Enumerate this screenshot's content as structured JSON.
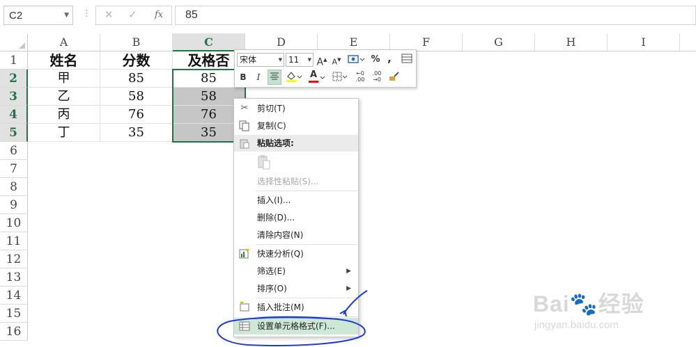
{
  "formula_bar": {
    "name_box": "C2",
    "cancel_icon": "✕",
    "enter_icon": "✓",
    "fx_label": "fx",
    "formula": "85"
  },
  "columns": [
    "A",
    "B",
    "C",
    "D",
    "E",
    "F",
    "G",
    "H",
    "I"
  ],
  "rows": [
    "1",
    "2",
    "3",
    "4",
    "5",
    "6",
    "7",
    "8",
    "9",
    "10",
    "11",
    "12",
    "13",
    "14",
    "15",
    "16"
  ],
  "selected_column": "C",
  "selected_rows": [
    "2",
    "3",
    "4",
    "5"
  ],
  "cells": {
    "A1": "姓名",
    "B1": "分数",
    "C1": "及格否",
    "A2": "甲",
    "B2": "85",
    "C2": "85",
    "A3": "乙",
    "B3": "58",
    "C3": "58",
    "A4": "丙",
    "B4": "76",
    "C4": "76",
    "A5": "丁",
    "B5": "35",
    "C5": "35"
  },
  "mini_toolbar": {
    "font_name": "宋体",
    "font_size": "11",
    "bold": "B",
    "italic": "I",
    "percent": "%",
    "comma": ",",
    "increase_font": "A",
    "decrease_font": "A",
    "font_color": "A",
    "fill_color_value": "#ffff00",
    "font_color_value": "#ff0000"
  },
  "context_menu": {
    "items": [
      {
        "label": "剪切(T)",
        "icon": "scissors-icon"
      },
      {
        "label": "复制(C)",
        "icon": "copy-icon"
      },
      {
        "label": "粘贴选项:",
        "icon": "paste-icon"
      },
      {
        "label": "选择性粘贴(S)...",
        "icon": ""
      },
      {
        "label": "插入(I)...",
        "icon": ""
      },
      {
        "label": "删除(D)...",
        "icon": ""
      },
      {
        "label": "清除内容(N)",
        "icon": ""
      },
      {
        "label": "快速分析(Q)",
        "icon": "quick-analysis-icon"
      },
      {
        "label": "筛选(E)",
        "icon": ""
      },
      {
        "label": "排序(O)",
        "icon": ""
      },
      {
        "label": "插入批注(M)",
        "icon": "comment-icon"
      },
      {
        "label": "设置单元格格式(F)...",
        "icon": "format-cells-icon"
      }
    ]
  },
  "watermark": {
    "brand": "Bai",
    "cn": "经验",
    "url": "jingyan.baidu.com"
  },
  "colors": {
    "excel_green": "#217346",
    "selection_gray": "#c6c6c6",
    "annotation_blue": "#1f3bd6"
  }
}
